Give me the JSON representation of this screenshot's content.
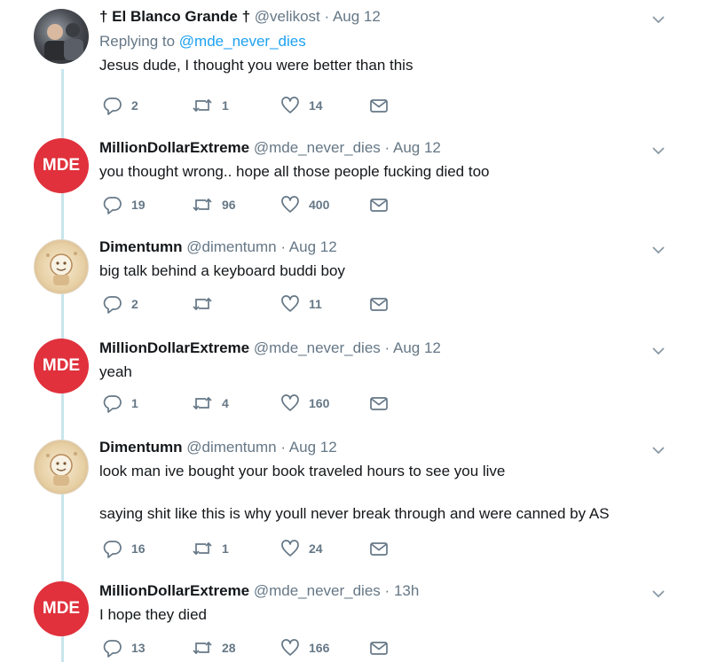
{
  "tweets": [
    {
      "display_name": "† El Blanco Grande †",
      "handle": "@velikost",
      "sep": "·",
      "timestamp": "Aug 12",
      "reply_prefix": "Replying to ",
      "reply_to": "@mde_never_dies",
      "text": "Jesus dude, I thought you were better than this",
      "replies": "2",
      "retweets": "1",
      "likes": "14",
      "avatar_label": ""
    },
    {
      "display_name": "MillionDollarExtreme",
      "handle": "@mde_never_dies",
      "sep": "·",
      "timestamp": "Aug 12",
      "text": "you thought wrong.. hope all those people fucking died too",
      "replies": "19",
      "retweets": "96",
      "likes": "400",
      "avatar_label": "MDE"
    },
    {
      "display_name": "Dimentumn",
      "handle": "@dimentumn",
      "sep": "·",
      "timestamp": "Aug 12",
      "text": "big talk behind a keyboard buddi boy",
      "replies": "2",
      "retweets": "",
      "likes": "11",
      "avatar_label": ""
    },
    {
      "display_name": "MillionDollarExtreme",
      "handle": "@mde_never_dies",
      "sep": "·",
      "timestamp": "Aug 12",
      "text": "yeah",
      "replies": "1",
      "retweets": "4",
      "likes": "160",
      "avatar_label": "MDE"
    },
    {
      "display_name": "Dimentumn",
      "handle": "@dimentumn",
      "sep": "·",
      "timestamp": "Aug 12",
      "text": "look man ive bought your book traveled hours to see you live\n\nsaying shit like this is why youll never break through and were canned by AS",
      "replies": "16",
      "retweets": "1",
      "likes": "24",
      "avatar_label": ""
    },
    {
      "display_name": "MillionDollarExtreme",
      "handle": "@mde_never_dies",
      "sep": "·",
      "timestamp": "13h",
      "text": "I hope they died",
      "replies": "13",
      "retweets": "28",
      "likes": "166",
      "avatar_label": "MDE"
    }
  ],
  "icons": {
    "reply": "reply-icon",
    "retweet": "retweet-icon",
    "like": "heart-icon",
    "dm": "envelope-icon",
    "more": "chevron-down-icon"
  },
  "colors": {
    "link": "#1da1f2",
    "secondary_text": "#657786",
    "thread_line": "#c8e6ec",
    "mde_red": "#e0313c"
  }
}
